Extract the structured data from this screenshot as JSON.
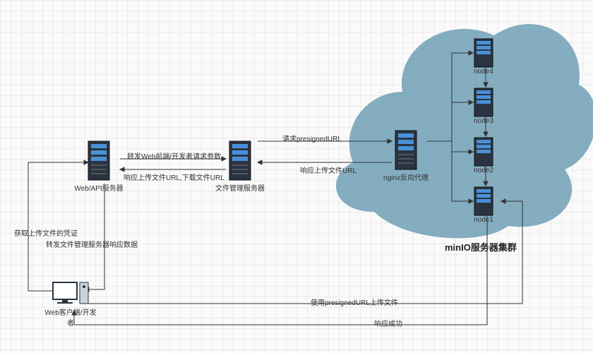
{
  "nodes": {
    "web_client": "Web客户端/开发者",
    "web_api": "Web/API服务器",
    "file_mgr": "文件管理服务器",
    "nginx": "nginx反向代理",
    "node1": "node1",
    "node2": "node2",
    "node3": "node3",
    "node4": "node4"
  },
  "cluster_title": "minIO服务器集群",
  "edges": {
    "e1": "获取上传文件的凭证",
    "e2": "转发文件管理服务器响应数据",
    "e3": "转发Web前端/开发者请求参数",
    "e4": "响应上传文件URL,下载文件URL",
    "e5": "请求presignedURL",
    "e6": "响应上传文件URL",
    "e7": "使用presignedURL上传文件",
    "e8": "响应成功"
  }
}
